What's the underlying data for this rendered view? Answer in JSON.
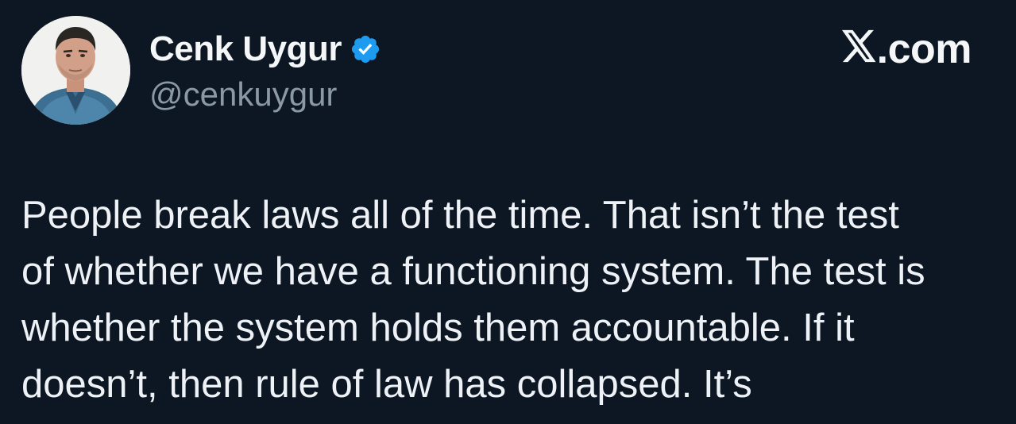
{
  "author": {
    "display_name": "Cenk Uygur",
    "handle": "@cenkuygur",
    "verified": true,
    "verified_icon": "verified-badge-icon",
    "avatar": "profile-photo"
  },
  "brand": {
    "label": ".com",
    "icon": "x-logo-icon"
  },
  "tweet": {
    "text": "People break laws all of the time. That isn’t the test\nof whether we have a functioning system. The test is\nwhether the system holds them accountable. If it\ndoesn’t, then rule of law has collapsed. It’s"
  },
  "colors": {
    "background": "#0c1723",
    "text": "#eef2f6",
    "handle": "#8b98a5",
    "verified": "#1d9bf0"
  }
}
